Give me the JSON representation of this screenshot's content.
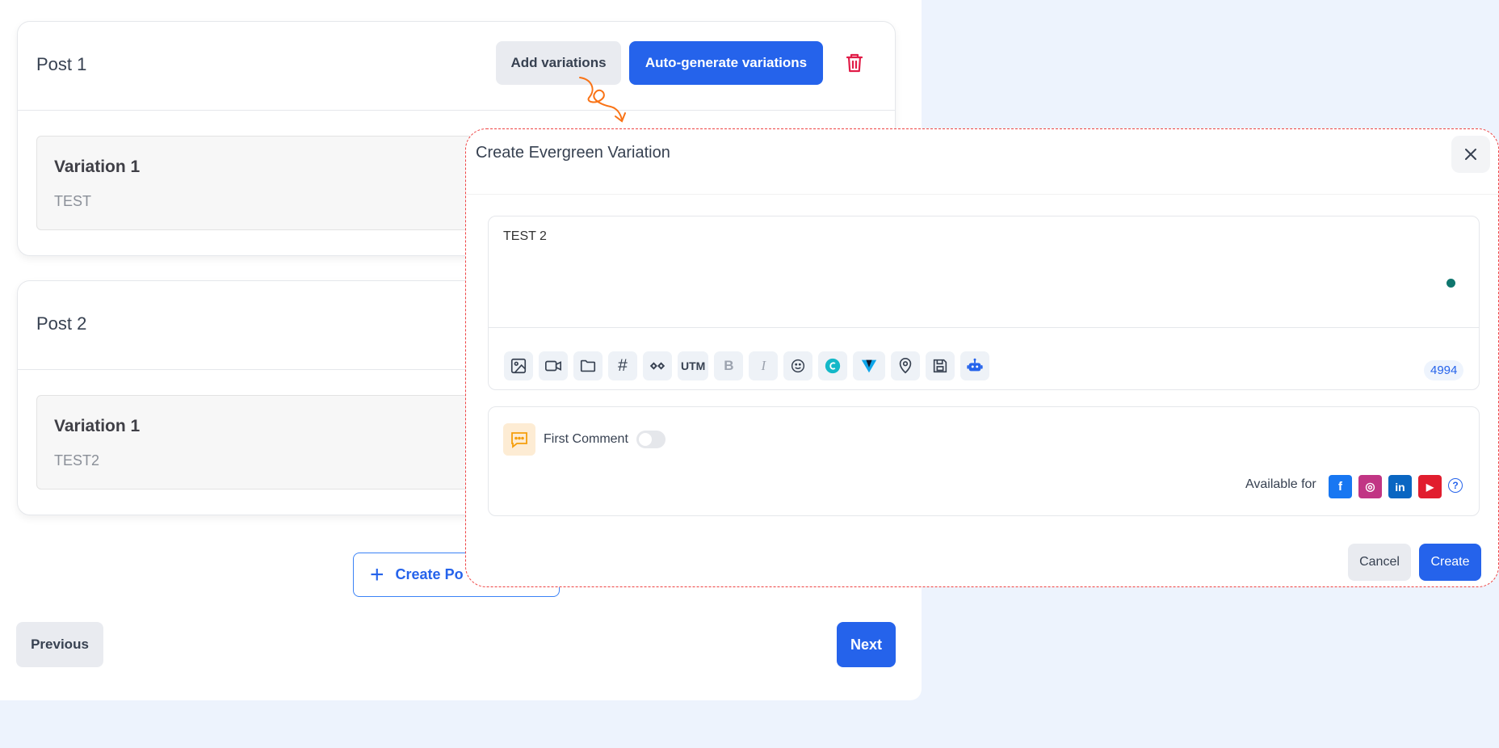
{
  "posts": [
    {
      "title": "Post 1",
      "variation_title": "Variation 1",
      "variation_text": "TEST"
    },
    {
      "title": "Post 2",
      "variation_title": "Variation 1",
      "variation_text": "TEST2"
    }
  ],
  "actions": {
    "add_variations": "Add variations",
    "auto_generate": "Auto-generate variations",
    "create_post": "Create Po",
    "previous": "Previous",
    "next": "Next"
  },
  "modal": {
    "title": "Create Evergreen Variation",
    "editor_text": "TEST 2",
    "char_count": "4994",
    "first_comment_label": "First Comment",
    "first_comment_enabled": false,
    "available_for_label": "Available for",
    "cancel_label": "Cancel",
    "create_label": "Create",
    "toolbar": [
      "image-icon",
      "video-icon",
      "folder-icon",
      "hashtag-icon",
      "link-shortener-icon",
      "utm-icon",
      "bold-icon",
      "italic-icon",
      "emoji-icon",
      "canva-icon",
      "vista-icon",
      "location-icon",
      "save-icon",
      "ai-bot-icon"
    ],
    "toolbar_text": {
      "hashtag": "#",
      "utm": "UTM",
      "bold": "B",
      "italic": "I"
    },
    "social": [
      {
        "name": "facebook-icon",
        "glyph": "f",
        "color": "#1877f2"
      },
      {
        "name": "instagram-icon",
        "glyph": "◎",
        "color": "#c13584"
      },
      {
        "name": "linkedin-icon",
        "glyph": "in",
        "color": "#0a66c2"
      },
      {
        "name": "youtube-icon",
        "glyph": "▶",
        "color": "#e11d2e"
      }
    ]
  },
  "colors": {
    "primary": "#2563eb",
    "danger": "#e11d48",
    "annotation": "#f97316"
  }
}
